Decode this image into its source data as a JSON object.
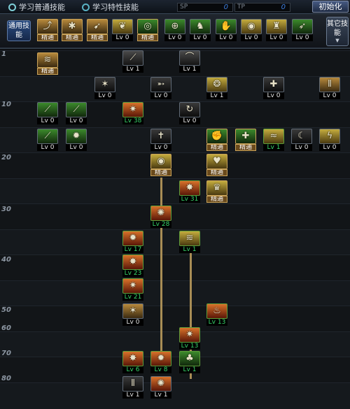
{
  "topbar": {
    "tab_common": "学习普通技能",
    "tab_special": "学习特性技能",
    "sp1_label": "SP",
    "sp1_value": "0",
    "sp2_label": "TP",
    "sp2_value": "0",
    "reset_label": "初始化"
  },
  "common": {
    "label": "通用技能",
    "other_label": "其它技能",
    "skills": [
      {
        "level": "精通",
        "icon": "rising-figure-icon",
        "glyph": "⤴",
        "bg": "c",
        "state": "mastered"
      },
      {
        "level": "精通",
        "icon": "kick-icon",
        "glyph": "✱",
        "bg": "c",
        "state": "mastered"
      },
      {
        "level": "精通",
        "icon": "dash-icon",
        "glyph": "➹",
        "bg": "c",
        "state": "mastered"
      },
      {
        "level": "Lv 0",
        "icon": "wings-icon",
        "glyph": "❦",
        "bg": "y",
        "state": "normal"
      },
      {
        "level": "精通",
        "icon": "target-icon",
        "glyph": "◎",
        "bg": "g",
        "state": "mastered"
      },
      {
        "level": "Lv 0",
        "icon": "crosshair-icon",
        "glyph": "⊕",
        "bg": "g",
        "state": "normal"
      },
      {
        "level": "Lv 0",
        "icon": "fighter-icon",
        "glyph": "♞",
        "bg": "g",
        "state": "normal"
      },
      {
        "level": "Lv 0",
        "icon": "grab-icon",
        "glyph": "✋",
        "bg": "g",
        "state": "normal"
      },
      {
        "level": "Lv 0",
        "icon": "eye-icon",
        "glyph": "◉",
        "bg": "y",
        "state": "normal"
      },
      {
        "level": "Lv 0",
        "icon": "armor-icon",
        "glyph": "♜",
        "bg": "y",
        "state": "normal"
      },
      {
        "level": "Lv 0",
        "icon": "leap-icon",
        "glyph": "➶",
        "bg": "g",
        "state": "normal"
      }
    ]
  },
  "levels": [
    "1",
    "10",
    "20",
    "30",
    "40",
    "50",
    "60",
    "70",
    "80"
  ],
  "tree": [
    {
      "level": "精通",
      "icon": "claw-icon",
      "glyph": "≋",
      "bg": "c",
      "state": "mastered"
    },
    {
      "level": "Lv 1",
      "icon": "spear-icon",
      "glyph": "⟋",
      "bg": "b",
      "state": "normal"
    },
    {
      "level": "Lv 1",
      "icon": "slash-icon",
      "glyph": "⌒",
      "bg": "b",
      "state": "normal"
    },
    {
      "level": "Lv 0",
      "icon": "burst-icon",
      "glyph": "✶",
      "bg": "d",
      "state": "normal"
    },
    {
      "level": "Lv 0",
      "icon": "arrow-icon",
      "glyph": "➵",
      "bg": "d",
      "state": "normal"
    },
    {
      "level": "Lv 1",
      "icon": "swirl-icon",
      "glyph": "❂",
      "bg": "y",
      "state": "normal"
    },
    {
      "level": "Lv 0",
      "icon": "shield-icon",
      "glyph": "✚",
      "bg": "d",
      "state": "normal"
    },
    {
      "level": "Lv 0",
      "icon": "triple-blade-icon",
      "glyph": "⫴",
      "bg": "c",
      "state": "normal"
    },
    {
      "level": "Lv 0",
      "icon": "green-blade-icon",
      "glyph": "⟋",
      "bg": "g",
      "state": "normal"
    },
    {
      "level": "Lv 0",
      "icon": "green-sword-icon",
      "glyph": "⟋",
      "bg": "g",
      "state": "normal"
    },
    {
      "level": "Lv 38",
      "icon": "fire-claw-icon",
      "glyph": "✷",
      "bg": "r",
      "state": "learned"
    },
    {
      "level": "Lv 0",
      "icon": "spin-icon",
      "glyph": "↻",
      "bg": "d",
      "state": "normal"
    },
    {
      "level": "Lv 0",
      "icon": "green-spike-icon",
      "glyph": "⟋",
      "bg": "g",
      "state": "normal"
    },
    {
      "level": "Lv 0",
      "icon": "green-star-icon",
      "glyph": "✹",
      "bg": "g",
      "state": "normal"
    },
    {
      "level": "Lv 0",
      "icon": "cross-sword-icon",
      "glyph": "✝",
      "bg": "d",
      "state": "normal"
    },
    {
      "level": "精通",
      "icon": "muscle-icon",
      "glyph": "✊",
      "bg": "g",
      "state": "mastered"
    },
    {
      "level": "精通",
      "icon": "holy-cross-icon",
      "glyph": "✚",
      "bg": "g",
      "state": "mastered"
    },
    {
      "level": "Lv 1",
      "icon": "wind-slash-icon",
      "glyph": "≈",
      "bg": "y",
      "state": "learned"
    },
    {
      "level": "Lv 0",
      "icon": "crescent-icon",
      "glyph": "☾",
      "bg": "d",
      "state": "normal"
    },
    {
      "level": "Lv 0",
      "icon": "flame-icon",
      "glyph": "ϟ",
      "bg": "y",
      "state": "normal"
    },
    {
      "level": "精通",
      "icon": "eye-orb-icon",
      "glyph": "◉",
      "bg": "y",
      "state": "mastered"
    },
    {
      "level": "精通",
      "icon": "heart-shield-icon",
      "glyph": "♥",
      "bg": "y",
      "state": "mastered"
    },
    {
      "level": "Lv 31",
      "icon": "fire-burst-icon",
      "glyph": "✸",
      "bg": "r",
      "state": "learned"
    },
    {
      "level": "精通",
      "icon": "lion-roar-icon",
      "glyph": "♛",
      "bg": "y",
      "state": "mastered"
    },
    {
      "level": "Lv 28",
      "icon": "explosion-icon",
      "glyph": "✺",
      "bg": "r",
      "state": "learned"
    },
    {
      "level": "Lv 17",
      "icon": "flame-fist-icon",
      "glyph": "✹",
      "bg": "r",
      "state": "learned"
    },
    {
      "level": "Lv 1",
      "icon": "tornado-icon",
      "glyph": "≋",
      "bg": "y",
      "state": "learned"
    },
    {
      "level": "Lv 23",
      "icon": "inferno-icon",
      "glyph": "✸",
      "bg": "r",
      "state": "learned"
    },
    {
      "level": "Lv 21",
      "icon": "fire-star-icon",
      "glyph": "✷",
      "bg": "r",
      "state": "learned"
    },
    {
      "level": "Lv 0",
      "icon": "strike-icon",
      "glyph": "✶",
      "bg": "c",
      "state": "normal"
    },
    {
      "level": "Lv 13",
      "icon": "dragon-icon",
      "glyph": "♨",
      "bg": "r",
      "state": "learned"
    },
    {
      "level": "Lv 13",
      "icon": "blaze-icon",
      "glyph": "✷",
      "bg": "r",
      "state": "learned"
    },
    {
      "level": "Lv 6",
      "icon": "fire-dash-icon",
      "glyph": "✸",
      "bg": "r",
      "state": "learned"
    },
    {
      "level": "Lv 8",
      "icon": "meteor-icon",
      "glyph": "✹",
      "bg": "r",
      "state": "learned"
    },
    {
      "level": "Lv 1",
      "icon": "green-beast-icon",
      "glyph": "♣",
      "bg": "g",
      "state": "learned"
    },
    {
      "level": "Lv 1",
      "icon": "blade-storm-icon",
      "glyph": "⫴",
      "bg": "d",
      "state": "normal"
    },
    {
      "level": "Lv 1",
      "icon": "final-blast-icon",
      "glyph": "✺",
      "bg": "r",
      "state": "normal"
    }
  ],
  "colors": {
    "accent": "#c9a35a",
    "learned": "#38d66b",
    "sp_number": "#3f7fe0"
  }
}
